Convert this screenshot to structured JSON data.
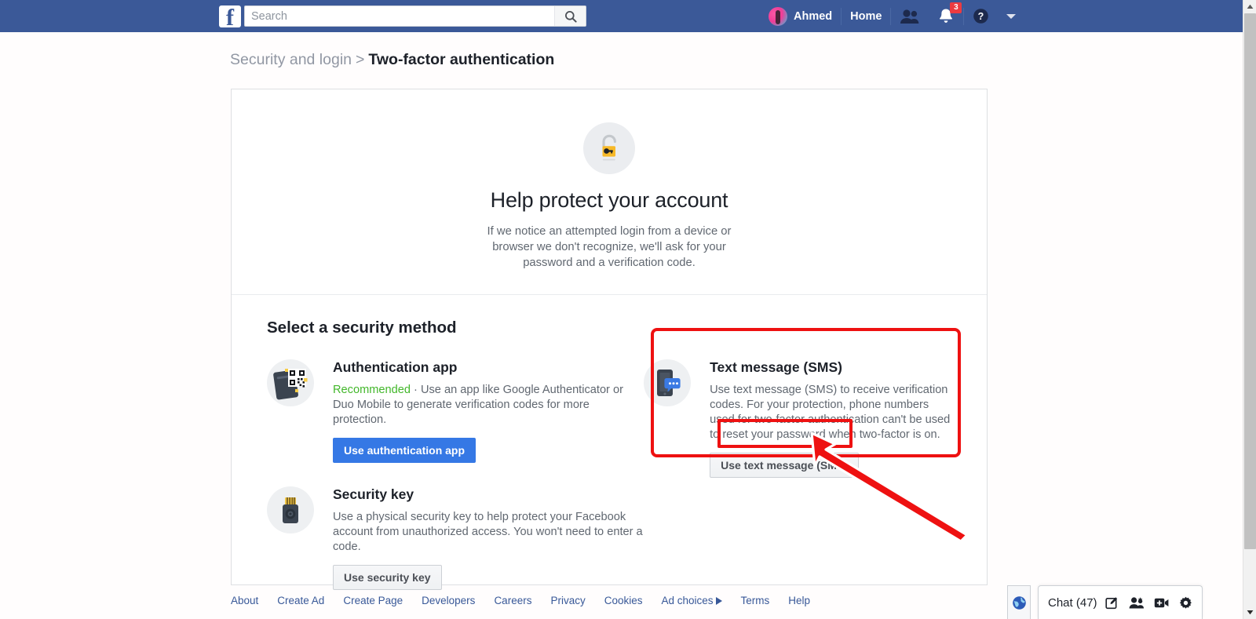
{
  "topbar": {
    "logo_icon": "facebook-logo",
    "search": {
      "placeholder": "Search",
      "value": "",
      "icon": "search-icon"
    },
    "profile_name": "Ahmed",
    "home_label": "Home",
    "friends_icon": "friend-requests-icon",
    "notifications_icon": "notifications-bell-icon",
    "notifications_count": "3",
    "help_icon": "help-icon",
    "account_menu_icon": "chevron-down-icon"
  },
  "breadcrumb": {
    "parent": "Security and login",
    "separator": ">",
    "current": "Two-factor authentication"
  },
  "hero": {
    "lock_icon": "open-padlock-icon",
    "title": "Help protect your account",
    "description": "If we notice an attempted login from a device or browser we don't recognize, we'll ask for your password and a verification code."
  },
  "methods_section": {
    "title": "Select a security method",
    "left": [
      {
        "icon": "authentication-app-qr-icon",
        "title": "Authentication app",
        "recommended_label": "Recommended",
        "separator": "·",
        "description": "Use an app like Google Authenticator or Duo Mobile to generate verification codes for more protection.",
        "button": "Use authentication app",
        "button_style": "primary"
      },
      {
        "icon": "usb-security-key-icon",
        "title": "Security key",
        "recommended_label": "",
        "separator": "",
        "description": "Use a physical security key to help protect your Facebook account from unauthorized access. You won't need to enter a code.",
        "button": "Use security key",
        "button_style": "secondary"
      }
    ],
    "right": [
      {
        "icon": "sms-phone-icon",
        "title": "Text message (SMS)",
        "description": "Use text message (SMS) to receive verification codes. For your protection, phone numbers used for two-factor authentication can't be used to reset your password when two-factor is on.",
        "button": "Use text message (SMS)",
        "button_style": "secondary"
      }
    ]
  },
  "annotations": {
    "highlight_color": "#ee1111",
    "card_highlight_target": "Text message (SMS)",
    "button_highlight_target": "Use text message (SMS)",
    "arrow_icon": "pointer-arrow"
  },
  "footer": {
    "links": [
      "About",
      "Create Ad",
      "Create Page",
      "Developers",
      "Careers",
      "Privacy",
      "Cookies",
      "Ad choices",
      "Terms",
      "Help"
    ],
    "adchoices_index": 7
  },
  "chatbar": {
    "globe_icon": "globe-icon",
    "label": "Chat (47)",
    "icons": [
      "compose-message-icon",
      "add-friends-icon",
      "video-room-icon",
      "chat-settings-gear-icon"
    ]
  },
  "scrollbar": {
    "up_icon": "scroll-up-arrow",
    "down_icon": "scroll-down-arrow"
  },
  "colors": {
    "facebook_blue": "#3b5998",
    "primary_button": "#3578e5",
    "recommended_green": "#42b72a",
    "annotation_red": "#ee1111",
    "body_text": "#606770",
    "heading_text": "#1d2129"
  }
}
